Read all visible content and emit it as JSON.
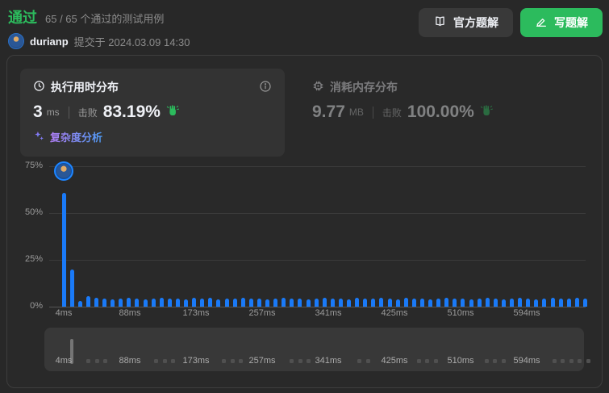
{
  "colors": {
    "accent_green": "#2cbb5d",
    "bar_blue": "#1a7af8",
    "link_gradient_from": "#b17ef7",
    "link_gradient_to": "#4e9bf5"
  },
  "header": {
    "status": "通过",
    "cases": "65 / 65 个通过的测试用例",
    "username": "durianp",
    "submitted": "提交于 2024.03.09 14:30",
    "official_solution_label": "官方题解",
    "write_solution_label": "写题解"
  },
  "runtime_card": {
    "title": "执行用时分布",
    "value": "3",
    "unit": "ms",
    "beats_label": "击败",
    "beats_value": "83.19%",
    "complexity_link": "复杂度分析"
  },
  "memory_card": {
    "title": "消耗内存分布",
    "value": "9.77",
    "unit": "MB",
    "beats_label": "击败",
    "beats_value": "100.00%"
  },
  "chart_data": {
    "type": "bar",
    "title": "执行用时分布",
    "xlabel": "",
    "ylabel": "",
    "ylim": [
      0,
      75
    ],
    "grid": "horizontal",
    "legend": "none",
    "y_ticks": [
      {
        "value": 0,
        "label": "0%"
      },
      {
        "value": 25,
        "label": "25%"
      },
      {
        "value": 50,
        "label": "50%"
      },
      {
        "value": 75,
        "label": "75%"
      }
    ],
    "x_tick_labels": [
      "4ms",
      "88ms",
      "173ms",
      "257ms",
      "341ms",
      "425ms",
      "510ms",
      "594ms"
    ],
    "highlight": {
      "index": 0,
      "x_label": "4ms",
      "marker": "user-avatar"
    },
    "values_pct": [
      60.5,
      19.5,
      3,
      5.5,
      4.5,
      4,
      3.5,
      4,
      4.5,
      4,
      3.5,
      4,
      4.5,
      4,
      4,
      3.5,
      4.5,
      4,
      4.5,
      3.5,
      4,
      4,
      4.5,
      4,
      4,
      3.5,
      4,
      4.5,
      4,
      4,
      3.5,
      4,
      4.5,
      4,
      4,
      3.5,
      4.5,
      4,
      4,
      4.5,
      4,
      3.5,
      4.5,
      4,
      4,
      3.5,
      4,
      4.5,
      4,
      4,
      3.5,
      4,
      4.5,
      4,
      3.5,
      4,
      4.5,
      4,
      3.5,
      4,
      4.5,
      4,
      4,
      4.5,
      4
    ]
  },
  "minimap": {
    "labels": [
      "4ms",
      "88ms",
      "173ms",
      "257ms",
      "341ms",
      "425ms",
      "510ms",
      "594ms"
    ],
    "spike_label": "4ms"
  },
  "icons": {
    "clock": "clock-icon",
    "chip": "memory-chip-icon",
    "info": "info-icon",
    "book": "book-icon",
    "pencil": "pencil-icon",
    "clap": "clap-icon",
    "sparkles": "sparkles-icon"
  }
}
